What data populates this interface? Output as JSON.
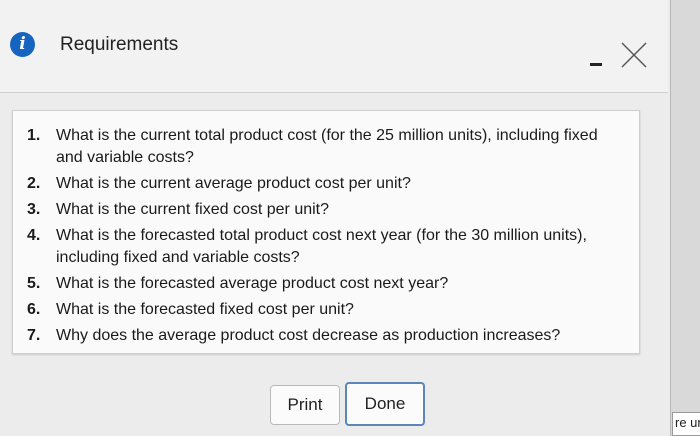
{
  "window": {
    "title": "Requirements",
    "icons": {
      "info": "info-icon",
      "minimize": "minimize-icon",
      "close": "close-icon"
    },
    "info_glyph": "i",
    "accent_color": "#1565c0"
  },
  "requirements": [
    {
      "num": "1.",
      "text": "What is the current total product cost (for the 25 million units), including fixed and variable costs?"
    },
    {
      "num": "2.",
      "text": "What is the current average product cost per unit?"
    },
    {
      "num": "3.",
      "text": "What is the current fixed cost per unit?"
    },
    {
      "num": "4.",
      "text": "What is the forecasted total product cost next year (for the 30 million units), including fixed and variable costs?"
    },
    {
      "num": "5.",
      "text": "What is the forecasted average product cost next year?"
    },
    {
      "num": "6.",
      "text": "What is the forecasted fixed cost per unit?"
    },
    {
      "num": "7.",
      "text": "Why does the average product cost decrease as production increases?"
    }
  ],
  "buttons": {
    "print": "Print",
    "done": "Done"
  },
  "background_fragment": "re un"
}
